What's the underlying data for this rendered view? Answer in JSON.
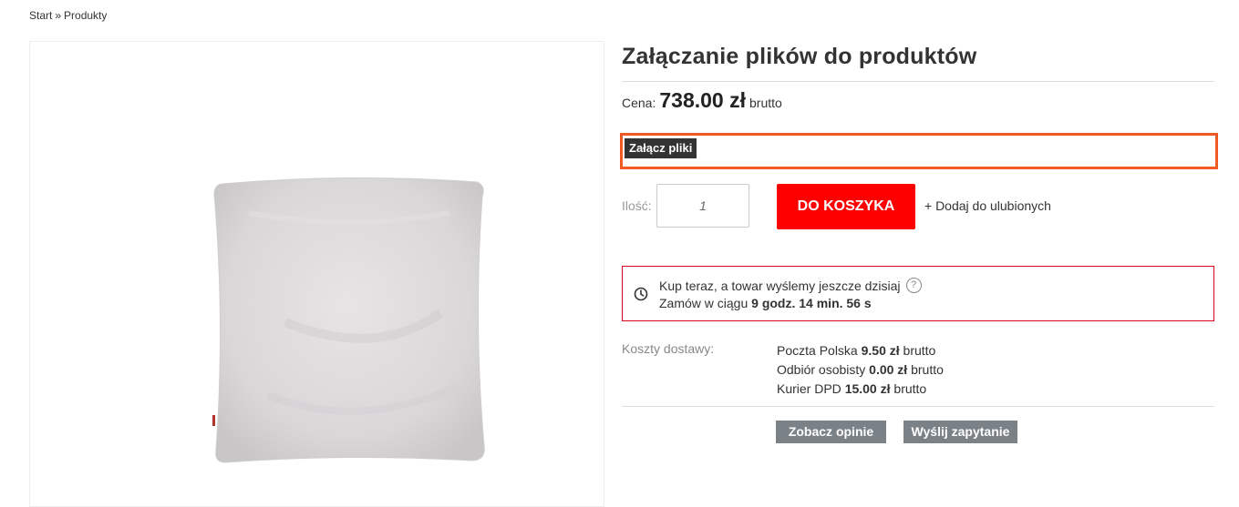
{
  "breadcrumb": {
    "items": [
      "Start",
      "Produkty"
    ],
    "separator": "»"
  },
  "product": {
    "title": "Załączanie plików do produktów",
    "price_label": "Cena:",
    "price_value": "738.00 zł",
    "price_suffix": "brutto"
  },
  "attach": {
    "label": "Załącz pliki",
    "highlight_color": "#f15a22"
  },
  "quantity": {
    "label": "Ilość:",
    "value": "1"
  },
  "cart": {
    "button_label": "DO KOSZYKA",
    "button_color": "#ff0000"
  },
  "favorites": {
    "link_label": "+ Dodaj do ulubionych"
  },
  "shipping_notice": {
    "line1": "Kup teraz, a towar wyślemy jeszcze dzisiaj",
    "help_icon": "?",
    "line2_prefix": "Zamów w ciągu",
    "countdown": "9 godz. 14 min. 56 s",
    "border_color": "#d9001b"
  },
  "delivery": {
    "label": "Koszty dostawy:",
    "options": [
      {
        "name": "Poczta Polska",
        "price": "9.50 zł",
        "suffix": "brutto"
      },
      {
        "name": "Odbiór osobisty",
        "price": "0.00 zł",
        "suffix": "brutto"
      },
      {
        "name": "Kurier DPD",
        "price": "15.00 zł",
        "suffix": "brutto"
      }
    ]
  },
  "actions": {
    "opinions_label": "Zobacz opinie",
    "inquiry_label": "Wyślij zapytanie"
  },
  "icons": {
    "clock": "clock-icon",
    "help": "question-icon"
  }
}
